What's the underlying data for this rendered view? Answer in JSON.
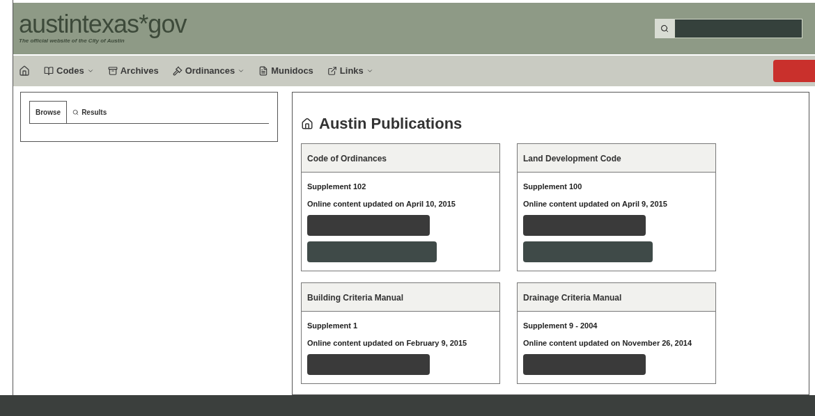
{
  "header": {
    "logo": "austintexas*gov",
    "tagline": "The official website of the City of Austin",
    "search": {
      "kind": "search"
    }
  },
  "nav": {
    "items": [
      {
        "label": "Codes",
        "dropdown": true
      },
      {
        "label": "Archives",
        "dropdown": false
      },
      {
        "label": "Ordinances",
        "dropdown": true
      },
      {
        "label": "Munidocs",
        "dropdown": false
      },
      {
        "label": "Links",
        "dropdown": true
      }
    ]
  },
  "sidebar": {
    "tabs": [
      {
        "label": "Browse",
        "selected": true
      },
      {
        "label": "Results",
        "selected": false
      }
    ]
  },
  "main": {
    "title": "Austin Publications",
    "cards": [
      {
        "title": "Code of Ordinances",
        "supplement": "Supplement 102",
        "updated": "Online content updated on April 10, 2015",
        "buttons": [
          {
            "kind": "dark"
          },
          {
            "kind": "teal"
          }
        ]
      },
      {
        "title": "Land Development Code",
        "supplement": "Supplement 100",
        "updated": "Online content updated on April 9, 2015",
        "buttons": [
          {
            "kind": "dark"
          },
          {
            "kind": "teal"
          }
        ]
      },
      {
        "title": "Building Criteria Manual",
        "supplement": "Supplement 1",
        "updated": "Online content updated on February 9, 2015",
        "buttons": [
          {
            "kind": "dark"
          }
        ]
      },
      {
        "title": "Drainage Criteria Manual",
        "supplement": "Supplement 9 - 2004",
        "updated": "Online content updated on November 26, 2014",
        "buttons": [
          {
            "kind": "dark"
          }
        ]
      }
    ]
  }
}
